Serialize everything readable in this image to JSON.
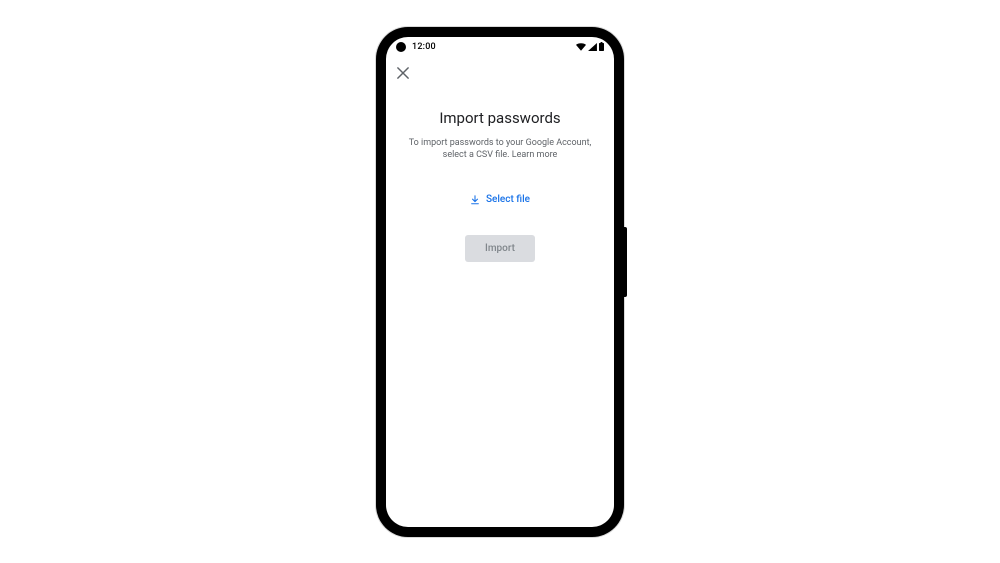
{
  "status_bar": {
    "time": "12:00"
  },
  "page": {
    "title": "Import passwords",
    "description": "To import passwords to your Google Account, select a CSV file. Learn more",
    "select_file_label": "Select file",
    "import_button_label": "Import"
  }
}
